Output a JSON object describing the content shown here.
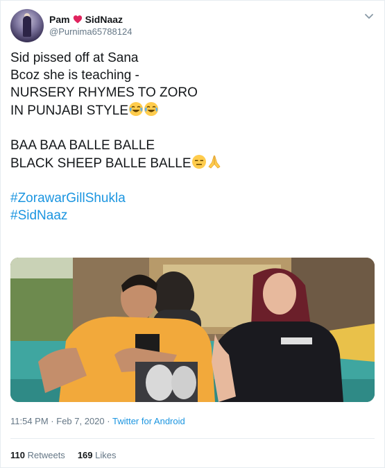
{
  "author": {
    "display_name_part1": "Pam",
    "display_name_part2": "SidNaaz",
    "handle": "@Purnima65788124",
    "heart_color": "#e0245e"
  },
  "tweet": {
    "lines": [
      "Sid pissed off at Sana",
      "Bcoz she is teaching -",
      "NURSERY RHYMES TO ZORO",
      "IN PUNJABI STYLE",
      "BAA BAA BALLE BALLE",
      "BLACK SHEEP BALLE BALLE"
    ],
    "hashtags": [
      "#ZorawarGillShukla",
      "#SidNaaz"
    ],
    "emojis": [
      "joy-emoji",
      "joy-emoji",
      "expressionless-emoji",
      "folded-hands-emoji"
    ]
  },
  "meta": {
    "time": "11:54 PM",
    "separator": " · ",
    "date": "Feb 7, 2020",
    "source": "Twitter for Android"
  },
  "stats": {
    "retweets_count": "110",
    "retweets_label": "Retweets",
    "likes_count": "169",
    "likes_label": "Likes"
  },
  "colors": {
    "link": "#1b95e0",
    "muted": "#657786",
    "text": "#14171a"
  }
}
